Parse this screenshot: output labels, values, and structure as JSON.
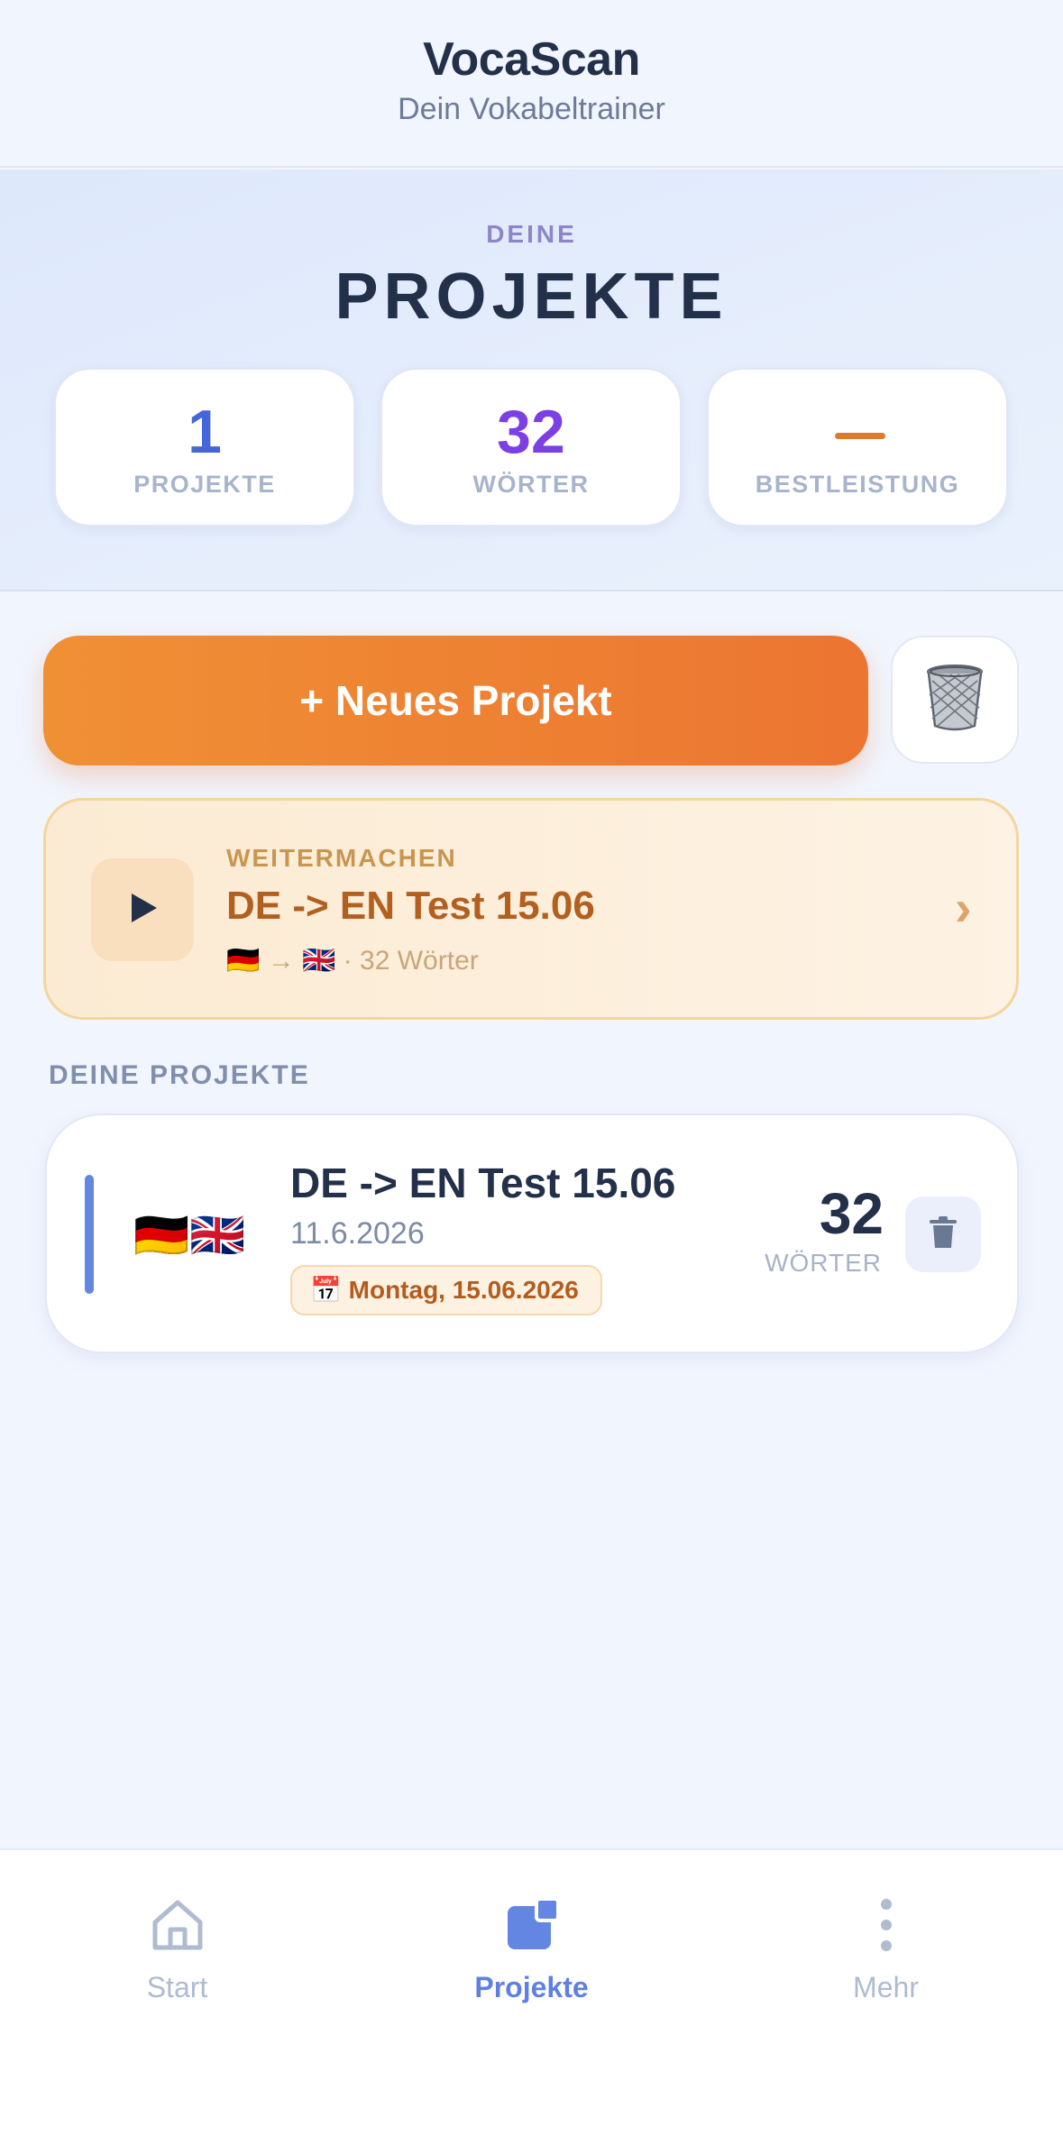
{
  "header": {
    "title": "VocaScan",
    "subtitle": "Dein Vokabeltrainer"
  },
  "hero": {
    "kicker": "DEINE",
    "title": "PROJEKTE",
    "stats": [
      {
        "value": "1",
        "label": "PROJEKTE",
        "color": "#4466db"
      },
      {
        "value": "32",
        "label": "WÖRTER",
        "color": "#7b3fe4"
      },
      {
        "value": "",
        "label": "BESTLEISTUNG",
        "color": "#dd7b2c"
      }
    ]
  },
  "actions": {
    "new_project_label": "+ Neues Projekt",
    "trash_icon": "wastebasket-icon"
  },
  "continue_card": {
    "kicker": "WEITERMACHEN",
    "title": "DE -> EN Test 15.06",
    "meta": "🇩🇪 → 🇬🇧 · 32 Wörter",
    "chevron": "›"
  },
  "projects_section": {
    "title": "DEINE PROJEKTE",
    "projects": [
      {
        "flags": "🇩🇪🇬🇧",
        "title": "DE -> EN Test 15.06",
        "date": "11.6.2026",
        "badge": "📅 Montag, 15.06.2026",
        "count": "32",
        "count_label": "WÖRTER"
      }
    ]
  },
  "bottom_nav": {
    "items": [
      {
        "label": "Start",
        "icon": "home-icon",
        "active": false
      },
      {
        "label": "Projekte",
        "icon": "projects-icon",
        "active": true
      },
      {
        "label": "Mehr",
        "icon": "more-vertical-icon",
        "active": false
      }
    ]
  },
  "colors": {
    "accent_orange": "#ec7531",
    "accent_blue": "#5f80e2",
    "text_dark": "#233049"
  }
}
